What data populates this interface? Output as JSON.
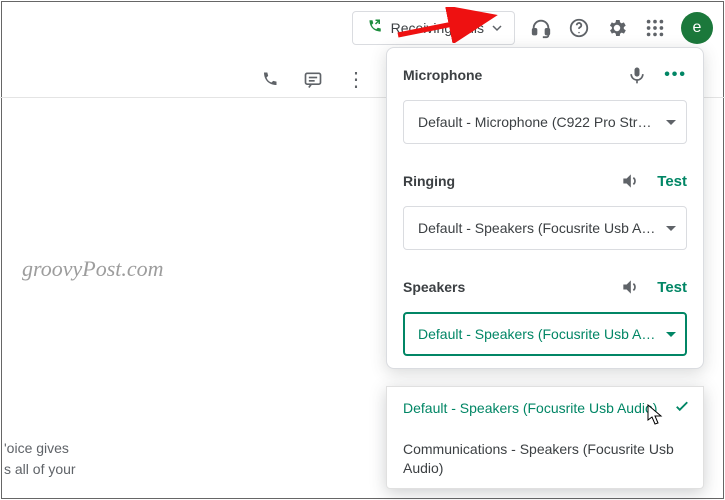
{
  "topbar": {
    "receiving_label": "Receiving calls",
    "avatar_initial": "e"
  },
  "panel": {
    "microphone": {
      "title": "Microphone",
      "value": "Default - Microphone (C922 Pro Strea..."
    },
    "ringing": {
      "title": "Ringing",
      "test_label": "Test",
      "value": "Default - Speakers (Focusrite Usb Aud..."
    },
    "speakers": {
      "title": "Speakers",
      "test_label": "Test",
      "value": "Default - Speakers (Focusrite Usb Aud..."
    }
  },
  "dropdown": {
    "option_selected": "Default - Speakers (Focusrite Usb Audio)",
    "option_other": "Communications - Speakers (Focusrite Usb Audio)"
  },
  "watermark": "groovyPost.com",
  "hint_line1": "'oice gives",
  "hint_line2": "s all of your"
}
